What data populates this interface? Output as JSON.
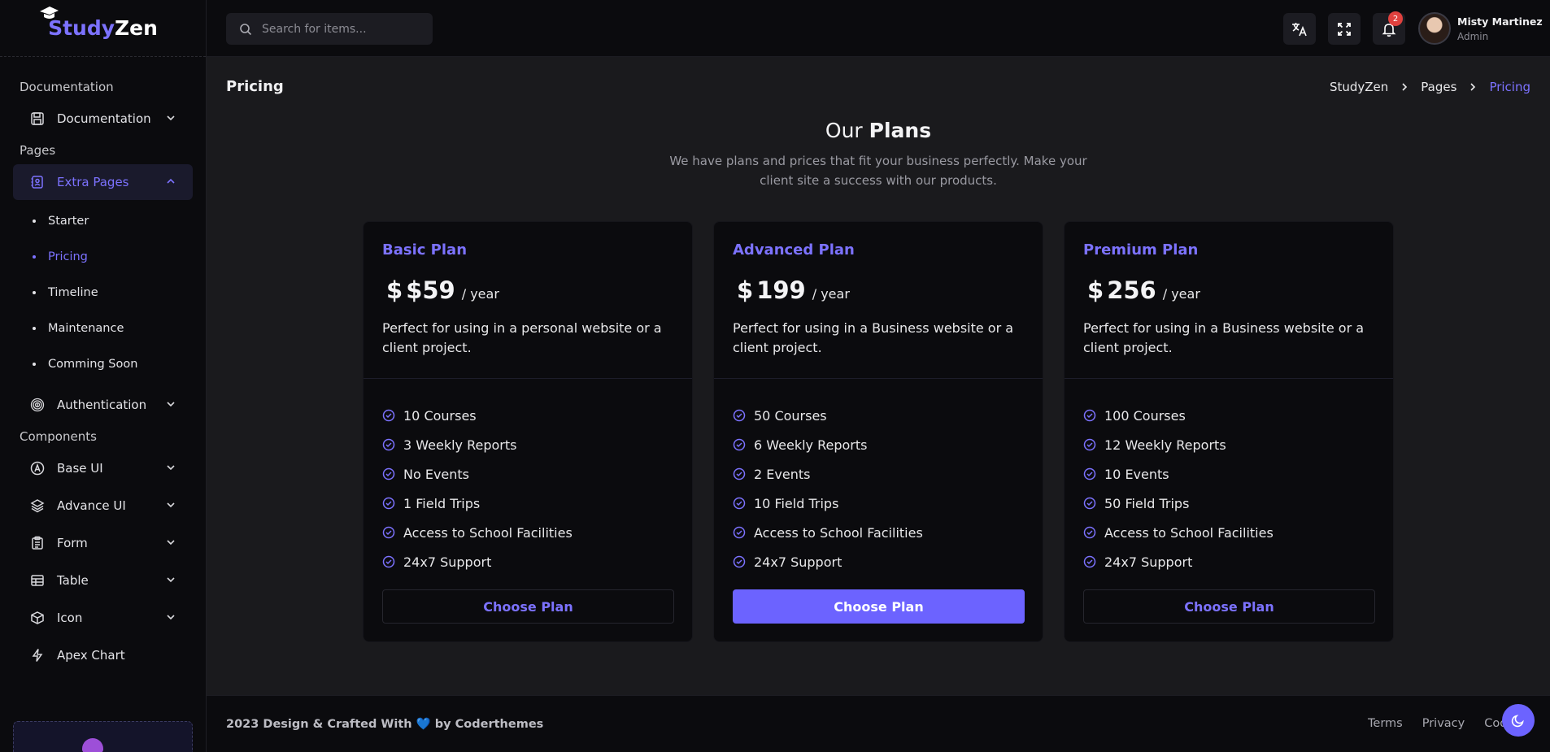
{
  "app": {
    "logo_part1": "Study",
    "logo_part2": "Zen"
  },
  "sidebar": {
    "sections": {
      "documentation": "Documentation",
      "pages": "Pages",
      "components": "Components"
    },
    "items": {
      "documentation": {
        "label": "Documentation",
        "icon": "save-icon"
      },
      "extra_pages": {
        "label": "Extra Pages",
        "icon": "contact-book-icon"
      },
      "authentication": {
        "label": "Authentication",
        "icon": "fingerprint-icon"
      },
      "base_ui": {
        "label": "Base UI",
        "icon": "a-circle-icon"
      },
      "advance_ui": {
        "label": "Advance UI",
        "icon": "layers-icon"
      },
      "form": {
        "label": "Form",
        "icon": "clipboard-icon"
      },
      "table": {
        "label": "Table",
        "icon": "table-icon"
      },
      "icon": {
        "label": "Icon",
        "icon": "box-icon"
      },
      "apex_chart": {
        "label": "Apex Chart",
        "icon": "lightning-icon"
      }
    },
    "extra_pages_sub": [
      "Starter",
      "Pricing",
      "Timeline",
      "Maintenance",
      "Comming Soon"
    ]
  },
  "topbar": {
    "search_placeholder": "Search for items...",
    "notification_count": "2",
    "user_name": "Misty Martinez",
    "user_role": "Admin"
  },
  "page": {
    "title": "Pricing",
    "breadcrumb": [
      "StudyZen",
      "Pages",
      "Pricing"
    ]
  },
  "pricing": {
    "heading_light": "Our ",
    "heading_bold": "Plans",
    "subheading": "We have plans and prices that fit your business perfectly. Make your client site a success with our products.",
    "plans": [
      {
        "name": "Basic Plan",
        "currency": "$",
        "price": "$59",
        "period": "/ year",
        "description": "Perfect for using in a personal website or a client project.",
        "features": [
          "10 Courses",
          "3 Weekly Reports",
          "No Events",
          "1 Field Trips",
          "Access to School Facilities",
          "24x7 Support"
        ],
        "button": "Choose Plan"
      },
      {
        "name": "Advanced Plan",
        "currency": "$",
        "price": "199",
        "period": "/ year",
        "description": "Perfect for using in a Business website or a client project.",
        "features": [
          "50 Courses",
          "6 Weekly Reports",
          "2 Events",
          "10 Field Trips",
          "Access to School Facilities",
          "24x7 Support"
        ],
        "button": "Choose Plan"
      },
      {
        "name": "Premium Plan",
        "currency": "$",
        "price": "256",
        "period": "/ year",
        "description": "Perfect for using in a Business website or a client project.",
        "features": [
          "100 Courses",
          "12 Weekly Reports",
          "10 Events",
          "50 Field Trips",
          "Access to School Facilities",
          "24x7 Support"
        ],
        "button": "Choose Plan"
      }
    ]
  },
  "footer": {
    "text_before": "2023 Design & Crafted With ",
    "heart": "💙",
    "text_after": " by Coderthemes",
    "links": [
      "Terms",
      "Privacy",
      "Cookies"
    ]
  },
  "colors": {
    "accent": "#6c63ff",
    "accent_text": "#7c72ff",
    "background": "#1a1a1d",
    "panel": "#0b0b0e"
  }
}
